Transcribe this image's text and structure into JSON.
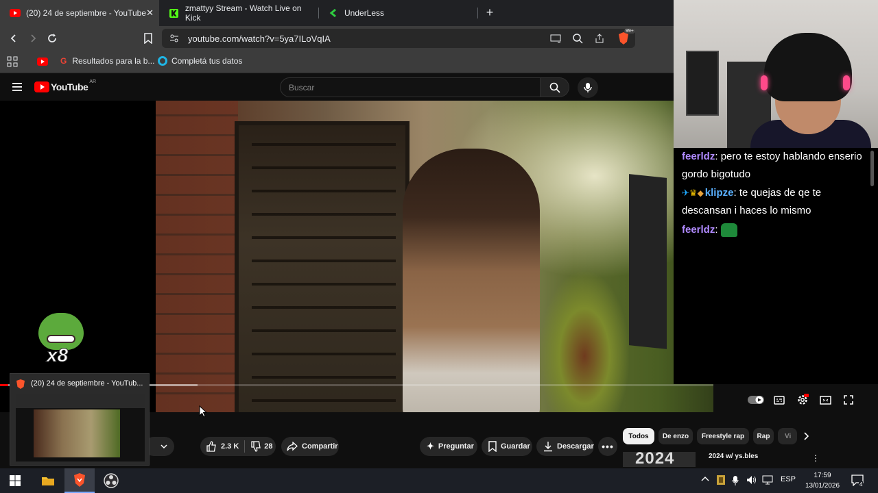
{
  "browser": {
    "tabs": [
      {
        "title": "(20) 24 de septiembre - YouTube",
        "active": true,
        "favicon": "youtube-icon",
        "color": "#ff0000"
      },
      {
        "title": "zmattyy Stream - Watch Live on Kick",
        "active": false,
        "favicon": "kick-icon",
        "color": "#53fc18"
      },
      {
        "title": "UnderLess",
        "active": false,
        "favicon": "underless-icon",
        "color": "#2ecc40"
      }
    ],
    "new_tab_label": "+",
    "close_tab_label": "✕",
    "url": "youtube.com/watch?v=5ya7ILoVqIA",
    "brave_badge": "99+",
    "bookmarks": [
      {
        "label": "Resultados para la b...",
        "icon": "google-icon"
      },
      {
        "label": "Completá tus datos",
        "icon": "ring-icon"
      }
    ]
  },
  "youtube": {
    "logo_text": "YouTube",
    "logo_region": "AR",
    "search_placeholder": "Buscar",
    "like_count": "2.3 K",
    "dislike_count": "28",
    "share_label": "Compartir",
    "ask_label": "Preguntar",
    "save_label": "Guardar",
    "download_label": "Descargar",
    "filter_chips": [
      "Todos",
      "De enzo",
      "Freestyle rap",
      "Rap",
      "Vi"
    ],
    "recommendation_title": "2024 w/ ys.bles",
    "recommendation_thumb_text": "2024"
  },
  "tab_preview": {
    "title": "(20) 24 de septiembre - YouTub..."
  },
  "overlay": {
    "emote_multiplier": "x8"
  },
  "chat": {
    "messages": [
      {
        "user": "feerldz",
        "user_color": "#b08aff",
        "text": "pero te estoy hablando enserio gordo bigotudo"
      },
      {
        "user": "klipze",
        "user_color": "#5ab0ff",
        "text": "te quejas de qe te descansan i haces lo mismo"
      },
      {
        "user": "feerldz",
        "user_color": "#b08aff",
        "text": ""
      }
    ]
  },
  "taskbar": {
    "language": "ESP",
    "time": "17:59",
    "date": "13/01/2026",
    "notification_count": "4"
  },
  "colors": {
    "youtube_red": "#ff0000",
    "chat_bg": "#000000"
  }
}
